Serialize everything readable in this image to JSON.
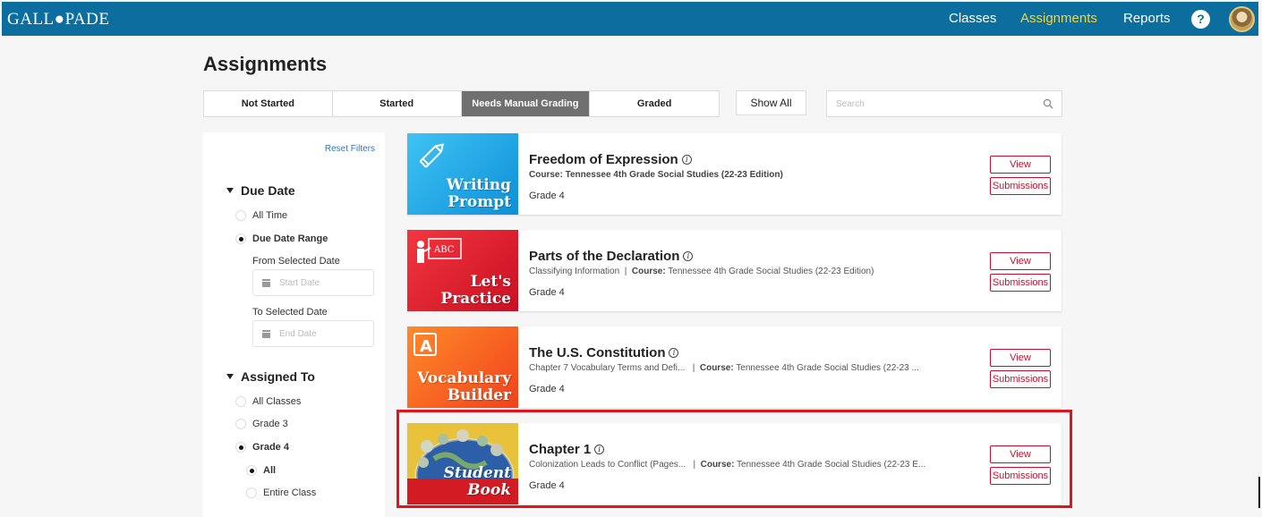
{
  "header": {
    "logo": "GALL●PADE",
    "nav": [
      "Classes",
      "Assignments",
      "Reports"
    ],
    "active_nav": "Assignments",
    "help_label": "?"
  },
  "page": {
    "title": "Assignments"
  },
  "tabs": [
    "Not Started",
    "Started",
    "Needs Manual Grading",
    "Graded"
  ],
  "selected_tab": "Needs Manual Grading",
  "show_all_label": "Show All",
  "search": {
    "placeholder": "Search"
  },
  "filters": {
    "reset_label": "Reset Filters",
    "due_date": {
      "heading": "Due Date",
      "options": [
        "All Time",
        "Due Date Range"
      ],
      "selected": "Due Date Range",
      "from_label": "From Selected Date",
      "from_placeholder": "Start Date",
      "to_label": "To Selected Date",
      "to_placeholder": "End Date"
    },
    "assigned_to": {
      "heading": "Assigned To",
      "options": [
        "All Classes",
        "Grade 3",
        "Grade 4"
      ],
      "selected": "Grade 4",
      "sub_options": [
        "All",
        "Entire Class"
      ],
      "sub_selected": "All"
    }
  },
  "assignments": [
    {
      "thumb_label_1": "Writing",
      "thumb_label_2": "Prompt",
      "title": "Freedom of Expression",
      "meta_prefix": "",
      "course_label": "Course:",
      "course": "Tennessee 4th Grade Social Studies (22-23 Edition)",
      "grade": "Grade 4",
      "view_label": "View",
      "submissions_label": "Submissions"
    },
    {
      "thumb_label_1": "Let's",
      "thumb_label_2": "Practice",
      "thumb_badge": "ABC",
      "title": "Parts of the Declaration",
      "meta_prefix": "Classifying Information",
      "course_label": "Course:",
      "course": "Tennessee 4th Grade Social Studies (22-23 Edition)",
      "grade": "Grade 4",
      "view_label": "View",
      "submissions_label": "Submissions"
    },
    {
      "thumb_label_1": "Vocabulary",
      "thumb_label_2": "Builder",
      "thumb_badge": "A",
      "title": "The U.S. Constitution",
      "meta_prefix": "Chapter 7 Vocabulary Terms and Defi...",
      "course_label": "Course:",
      "course": "Tennessee 4th Grade Social Studies (22-23 ...",
      "grade": "Grade 4",
      "view_label": "View",
      "submissions_label": "Submissions"
    },
    {
      "thumb_label_1": "Student Book",
      "title": "Chapter 1",
      "meta_prefix": "Colonization Leads to Conflict (Pages...",
      "course_label": "Course:",
      "course": "Tennessee 4th Grade Social Studies (22-23 E...",
      "grade": "Grade 4",
      "view_label": "View",
      "submissions_label": "Submissions"
    }
  ],
  "colors": {
    "header_bg": "#0b6e9e",
    "active_nav": "#f2d43d",
    "accent_red": "#c8102e",
    "highlight": "#e0141c",
    "selected_tab": "#707070"
  }
}
